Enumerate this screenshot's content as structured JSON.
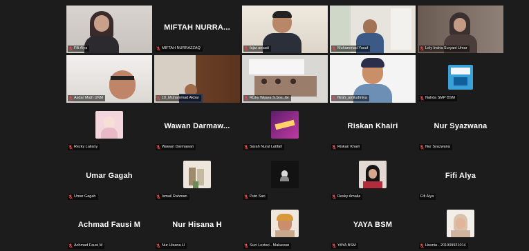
{
  "app": "video-meeting-gallery-view",
  "accent": {
    "active_speaker_border": "#23d96a",
    "muted_icon": "#e34a4a",
    "tile_bg": "#1c1c1c"
  },
  "tiles": [
    {
      "label": "Fifi Alya",
      "muted": true,
      "kind": "video"
    },
    {
      "label": "MIFTAH NURRAZZAQ",
      "big": "MIFTAH NURRA...",
      "muted": true,
      "kind": "name"
    },
    {
      "label": "fajar ansadi",
      "muted": true,
      "kind": "video"
    },
    {
      "label": "Muhammad Yusuf",
      "muted": true,
      "kind": "video",
      "active": true
    },
    {
      "label": "Lely Indria Suryani Umar",
      "muted": true,
      "kind": "video"
    },
    {
      "label": "Asdar Math UNM",
      "muted": true,
      "kind": "video"
    },
    {
      "label": "10_Muhammad Akbar",
      "muted": true,
      "kind": "video"
    },
    {
      "label": "Rizky Wijaya S.Sos.,Gr",
      "muted": true,
      "kind": "video"
    },
    {
      "label": "fitrah_amiludiniya",
      "muted": true,
      "kind": "video"
    },
    {
      "label": "Nahda SMP BSM",
      "muted": true,
      "kind": "video"
    },
    {
      "label": "Rezky Lailany",
      "muted": true,
      "kind": "avatar"
    },
    {
      "label": "Wawan Darmawan",
      "big": "Wawan Darmaw...",
      "muted": true,
      "kind": "name"
    },
    {
      "label": "Sarah Nurul Latifah",
      "muted": true,
      "kind": "avatar"
    },
    {
      "label": "Riskan Khairi",
      "big": "Riskan Khairi",
      "muted": true,
      "kind": "name"
    },
    {
      "label": "Nur Syazwana",
      "big": "Nur Syazwana",
      "muted": true,
      "kind": "name"
    },
    {
      "label": "Umar Gagah",
      "big": "Umar Gagah",
      "muted": true,
      "kind": "name"
    },
    {
      "label": "Ismail Rahman",
      "muted": true,
      "kind": "avatar"
    },
    {
      "label": "Putri Sari",
      "muted": true,
      "kind": "avatar"
    },
    {
      "label": "Resky Amalia",
      "muted": true,
      "kind": "avatar"
    },
    {
      "label": "Fifi Alya",
      "big": "Fifi Alya",
      "muted": false,
      "kind": "name"
    },
    {
      "label": "Achmad Fausi M",
      "big": "Achmad Fausi M",
      "muted": true,
      "kind": "name"
    },
    {
      "label": "Nur Hisana H",
      "big": "Nur Hisana H",
      "muted": true,
      "kind": "name"
    },
    {
      "label": "Suci Lestari - Makassar",
      "muted": true,
      "kind": "avatar"
    },
    {
      "label": "YAYA BSM",
      "big": "YAYA BSM",
      "muted": true,
      "kind": "name"
    },
    {
      "label": "Husnia - 201909921014",
      "muted": true,
      "kind": "avatar"
    }
  ]
}
